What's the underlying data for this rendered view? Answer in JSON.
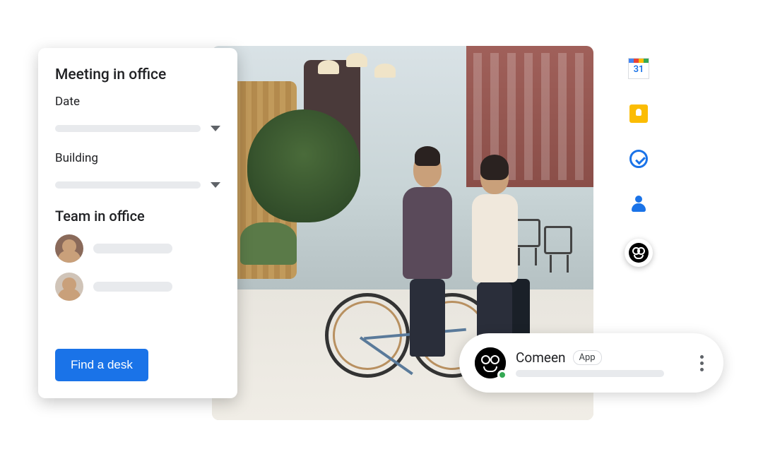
{
  "meeting_card": {
    "title": "Meeting in office",
    "date_label": "Date",
    "building_label": "Building",
    "team_section_title": "Team in office",
    "cta_label": "Find a desk"
  },
  "sidebar_icons": {
    "calendar": {
      "name": "calendar-icon",
      "day_number": "31"
    },
    "keep": {
      "name": "keep-icon"
    },
    "tasks": {
      "name": "tasks-icon"
    },
    "contacts": {
      "name": "contacts-icon"
    },
    "comeen": {
      "name": "comeen-icon"
    }
  },
  "chat_pill": {
    "app_name": "Comeen",
    "badge_label": "App",
    "presence": "online"
  }
}
